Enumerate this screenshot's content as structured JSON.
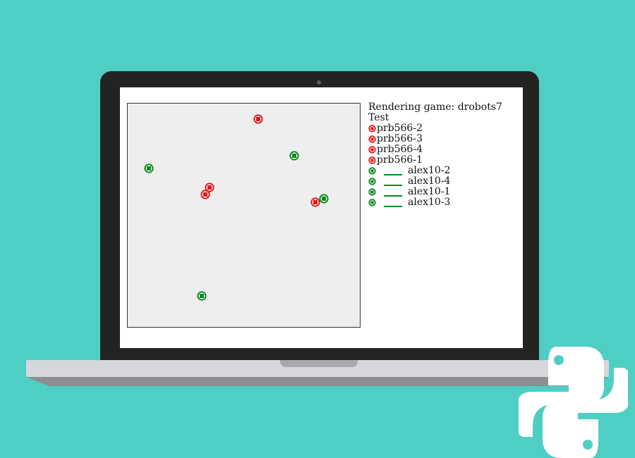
{
  "game": {
    "title": "Rendering game: drobots7",
    "subtitle": "Test"
  },
  "players": [
    {
      "name": "prb566-2",
      "team": "red",
      "has_health_bar": false
    },
    {
      "name": "prb566-3",
      "team": "red",
      "has_health_bar": false
    },
    {
      "name": "prb566-4",
      "team": "red",
      "has_health_bar": false
    },
    {
      "name": "prb566-1",
      "team": "red",
      "has_health_bar": false
    },
    {
      "name": "alex10-2",
      "team": "green",
      "has_health_bar": true
    },
    {
      "name": "alex10-4",
      "team": "green",
      "has_health_bar": true
    },
    {
      "name": "alex10-1",
      "team": "green",
      "has_health_bar": true
    },
    {
      "name": "alex10-3",
      "team": "green",
      "has_health_bar": true
    }
  ],
  "colors": {
    "background": "#4fcec4",
    "red_team": "#e31a1c",
    "green_team": "#0a8a1f",
    "arena": "#eeeeee"
  },
  "icons": {
    "robot": "circle-square-icon",
    "logo": "python-logo"
  }
}
